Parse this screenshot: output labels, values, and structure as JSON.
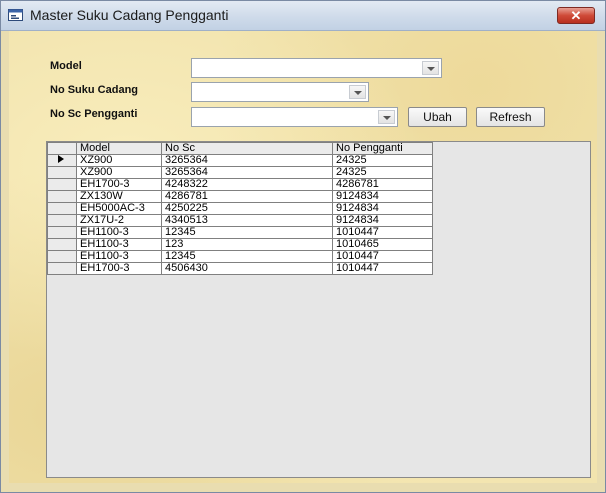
{
  "window": {
    "title": "Master Suku Cadang Pengganti",
    "close_symbol": "✕",
    "app_icon": "form-icon"
  },
  "form": {
    "model_label": "Model",
    "model_value": "",
    "suku_cadang_label": "No Suku Cadang",
    "suku_cadang_value": "",
    "pengganti_label": "No Sc Pengganti",
    "pengganti_value": "",
    "ubah_label": "Ubah",
    "refresh_label": "Refresh"
  },
  "grid": {
    "columns": [
      "Model",
      "No Sc",
      "No Pengganti"
    ],
    "rows": [
      [
        "XZ900",
        "3265364",
        "24325"
      ],
      [
        "XZ900",
        "3265364",
        "24325"
      ],
      [
        "EH1700-3",
        "4248322",
        "4286781"
      ],
      [
        "ZX130W",
        "4286781",
        "9124834"
      ],
      [
        "EH5000AC-3",
        "4250225",
        "9124834"
      ],
      [
        "ZX17U-2",
        "4340513",
        "9124834"
      ],
      [
        "EH1100-3",
        "12345",
        "1010447"
      ],
      [
        "EH1100-3",
        "123",
        "1010465"
      ],
      [
        "EH1100-3",
        "12345",
        "1010447"
      ],
      [
        "EH1700-3",
        "4506430",
        "1010447"
      ]
    ],
    "selected_row": 0
  },
  "colors": {
    "background": "#f1e3ad",
    "close_button": "#cf4a38"
  }
}
